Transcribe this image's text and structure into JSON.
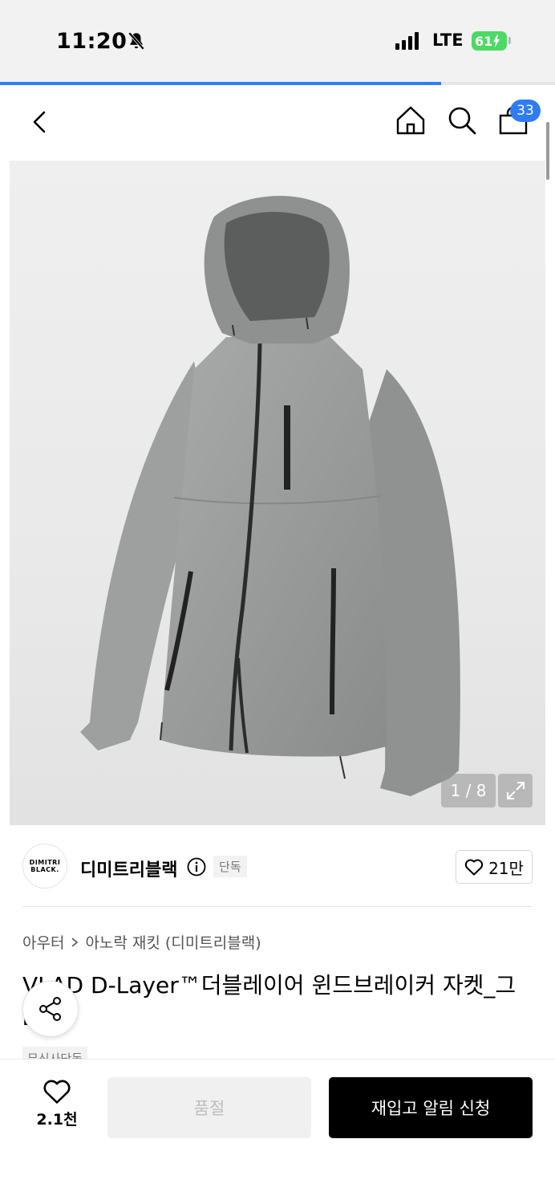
{
  "status_bar": {
    "time": "11:20",
    "network": "LTE",
    "battery": "61"
  },
  "page_progress": 0.795,
  "header": {
    "cart_count": "33"
  },
  "gallery": {
    "counter": "1 / 8"
  },
  "brand": {
    "logo_text": [
      "DIMITRI",
      "BLACK."
    ],
    "name": "디미트리블랙",
    "exclusive_label": "단독",
    "like_count": "21만"
  },
  "breadcrumb": {
    "category": "아우터",
    "subcategory": "아노락 재킷 (디미트리블랙)"
  },
  "product": {
    "title": "VLAD D-Layer™더블레이어 윈드브레이커 자켓_그레이",
    "tag": "무신사단독"
  },
  "bottom_bar": {
    "wishlist_count": "2.1천",
    "soldout_label": "품절",
    "restock_label": "재입고 알림 신청"
  },
  "colors": {
    "accent": "#2f7df6",
    "battery": "#4cd964",
    "jacket": "#9a9c9b"
  },
  "icons": [
    "bell-slash-icon",
    "signal-icon",
    "battery-icon",
    "back-icon",
    "home-icon",
    "search-icon",
    "cart-icon",
    "expand-icon",
    "info-icon",
    "heart-icon",
    "share-icon"
  ]
}
